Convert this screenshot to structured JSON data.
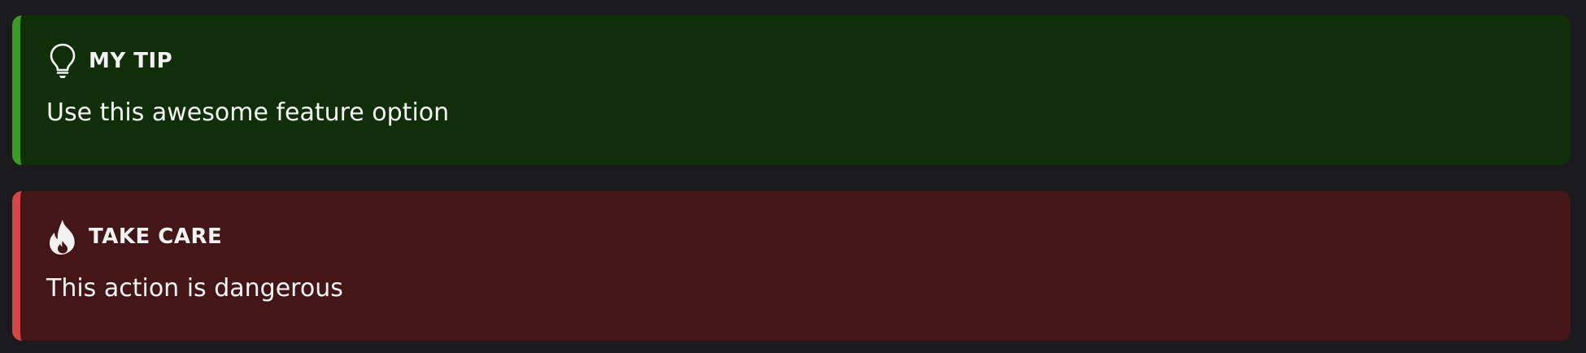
{
  "admonitions": [
    {
      "kind": "tip",
      "icon": "lightbulb-icon",
      "title": "MY TIP",
      "body": "Use this awesome feature option",
      "accent_color": "#3d9a26",
      "background_color": "#102f09"
    },
    {
      "kind": "danger",
      "icon": "fire-icon",
      "title": "TAKE CARE",
      "body": "This action is dangerous",
      "accent_color": "#d34748",
      "background_color": "#451618"
    }
  ]
}
